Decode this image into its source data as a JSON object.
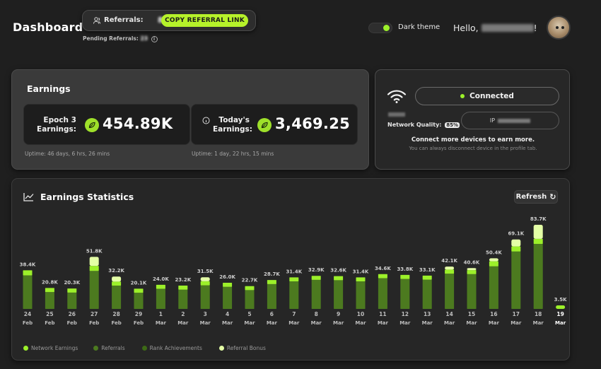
{
  "header": {
    "title": "Dashboard",
    "referrals_label": "Referrals:",
    "referrals_count": "84",
    "copy_button": "COPY REFERRAL LINK",
    "pending_label": "Pending Referrals:",
    "pending_count": "23",
    "theme_label": "Dark theme",
    "greeting": "Hello,",
    "greeting_suffix": "!"
  },
  "earnings": {
    "title": "Earnings",
    "epoch_label_1": "Epoch 3",
    "epoch_label_2": "Earnings:",
    "epoch_value": "454.89K",
    "today_label_1": "Today's",
    "today_label_2": "Earnings:",
    "today_value": "3,469.25",
    "epoch_uptime": "Uptime: 46 days, 6 hrs, 26 mins",
    "today_uptime": "Uptime: 1 day, 22 hrs, 15 mins"
  },
  "network": {
    "status": "Connected",
    "quality_label": "Network Quality:",
    "quality_value": "85%",
    "ip_label": "IP",
    "more_devices": "Connect more devices to earn more.",
    "disconnect_hint": "You can always disconnect device in the profile tab."
  },
  "stats": {
    "title": "Earnings Statistics",
    "refresh_label": "Refresh"
  },
  "colors": {
    "accent": "#b6f22a",
    "network": "#9cf02a",
    "referrals": "#4c7a1f",
    "rank": "#3d6a16",
    "bonus": "#e4ffa6"
  },
  "chart_data": {
    "type": "bar",
    "stacked": true,
    "categories": [
      [
        "24",
        "Feb"
      ],
      [
        "25",
        "Feb"
      ],
      [
        "26",
        "Feb"
      ],
      [
        "27",
        "Feb"
      ],
      [
        "28",
        "Feb"
      ],
      [
        "29",
        "Feb"
      ],
      [
        "1",
        "Mar"
      ],
      [
        "2",
        "Mar"
      ],
      [
        "3",
        "Mar"
      ],
      [
        "4",
        "Mar"
      ],
      [
        "5",
        "Mar"
      ],
      [
        "6",
        "Mar"
      ],
      [
        "7",
        "Mar"
      ],
      [
        "8",
        "Mar"
      ],
      [
        "9",
        "Mar"
      ],
      [
        "10",
        "Mar"
      ],
      [
        "11",
        "Mar"
      ],
      [
        "12",
        "Mar"
      ],
      [
        "13",
        "Mar"
      ],
      [
        "14",
        "Mar"
      ],
      [
        "15",
        "Mar"
      ],
      [
        "16",
        "Mar"
      ],
      [
        "17",
        "Mar"
      ],
      [
        "18",
        "Mar"
      ],
      [
        "19",
        "Mar"
      ]
    ],
    "totals": [
      38.4,
      20.8,
      20.3,
      51.8,
      32.2,
      20.1,
      24.0,
      23.2,
      31.5,
      26.0,
      22.7,
      28.7,
      31.4,
      32.9,
      32.6,
      31.4,
      34.6,
      33.8,
      33.1,
      42.1,
      40.6,
      50.4,
      69.1,
      83.7,
      3.5
    ],
    "total_labels": [
      "38.4K",
      "20.8K",
      "20.3K",
      "51.8K",
      "32.2K",
      "20.1K",
      "24.0K",
      "23.2K",
      "31.5K",
      "26.0K",
      "22.7K",
      "28.7K",
      "31.4K",
      "32.9K",
      "32.6K",
      "31.4K",
      "34.6K",
      "33.8K",
      "33.1K",
      "42.1K",
      "40.6K",
      "50.4K",
      "69.1K",
      "83.7K",
      "3.5K"
    ],
    "series": [
      {
        "name": "Network Earnings",
        "color": "#9cf02a",
        "values": [
          5,
          4,
          4,
          5,
          4,
          4,
          4,
          4,
          4,
          4,
          4,
          4,
          4,
          4,
          4,
          4,
          4,
          4,
          4,
          4,
          4,
          5,
          5,
          5,
          3.5
        ]
      },
      {
        "name": "Referrals",
        "color": "#4c7a1f",
        "values": [
          33.4,
          16.8,
          16.3,
          37.8,
          23.2,
          16.1,
          20,
          19.2,
          23.5,
          22,
          18.7,
          24.7,
          27.4,
          28.9,
          28.6,
          27.4,
          30.6,
          29.8,
          29.1,
          35.1,
          34.6,
          42.4,
          57.1,
          64.7,
          0
        ]
      },
      {
        "name": "Rank Achievements",
        "color": "#3d6a16",
        "values": [
          0,
          0,
          0,
          0,
          0,
          0,
          0,
          0,
          0,
          0,
          0,
          0,
          0,
          0,
          0,
          0,
          0,
          0,
          0,
          0,
          0,
          0,
          0,
          0,
          0
        ]
      },
      {
        "name": "Referral Bonus",
        "color": "#e4ffa6",
        "values": [
          0,
          0,
          0,
          9,
          5,
          0,
          0,
          0,
          4,
          0,
          0,
          0,
          0,
          0,
          0,
          0,
          0,
          0,
          0,
          3,
          2,
          3,
          7,
          14,
          0
        ]
      }
    ],
    "highlight_last": true,
    "ylim": [
      0,
      90
    ]
  }
}
